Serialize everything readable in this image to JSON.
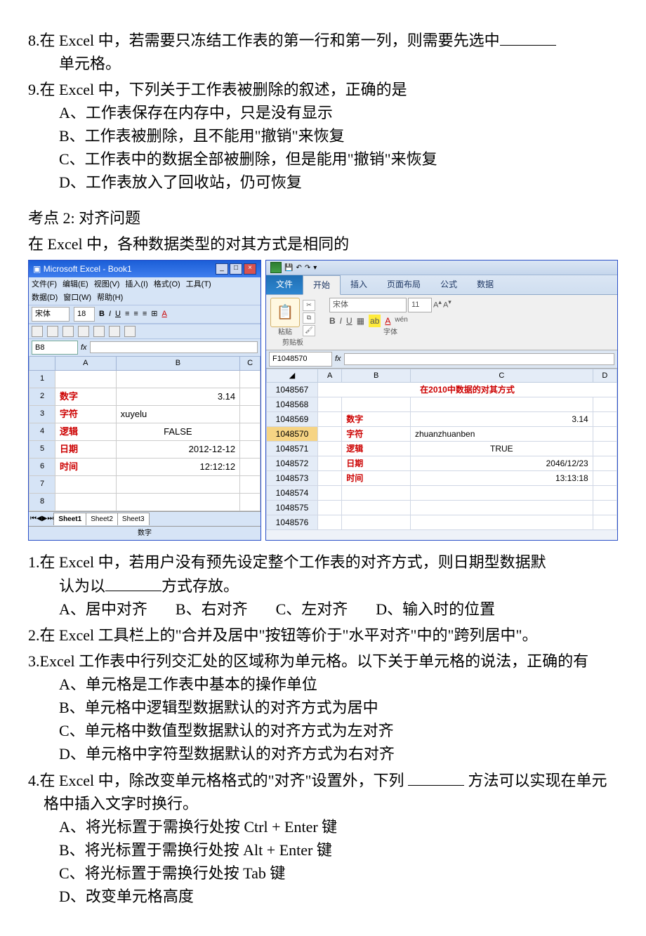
{
  "q8": {
    "text_a": "8.在 Excel 中，若需要只冻结工作表的第一行和第一列，则需要先选中",
    "text_b": "单元格。"
  },
  "q9": {
    "text": "9.在 Excel 中，下列关于工作表被删除的叙述，正确的是",
    "A": "A、工作表保存在内存中，只是没有显示",
    "B": "B、工作表被删除，且不能用\"撤销\"来恢复",
    "C": "C、工作表中的数据全部被删除，但是能用\"撤销\"来恢复",
    "D": "D、工作表放入了回收站，仍可恢复"
  },
  "kd2": {
    "title": "考点 2: 对齐问题",
    "intro": " 在 Excel 中，各种数据类型的对其方式是相同的"
  },
  "excel2003": {
    "title": "Microsoft Excel - Book1",
    "menus": [
      "文件(F)",
      "编辑(E)",
      "视图(V)",
      "插入(I)",
      "格式(O)",
      "工具(T)",
      "数据(D)",
      "窗口(W)",
      "帮助(H)"
    ],
    "font": "宋体",
    "fontsize": "18",
    "namebox": "B8",
    "cols": [
      "",
      "A",
      "B",
      "C"
    ],
    "rows": [
      {
        "n": "1",
        "a": "",
        "b": "",
        "c": ""
      },
      {
        "n": "2",
        "a": "数字",
        "b": "3.14",
        "c": "",
        "balign": "right",
        "ared": true
      },
      {
        "n": "3",
        "a": "字符",
        "b": "xuyelu",
        "c": "",
        "balign": "left",
        "ared": true
      },
      {
        "n": "4",
        "a": "逻辑",
        "b": "FALSE",
        "c": "",
        "balign": "center",
        "ared": true
      },
      {
        "n": "5",
        "a": "日期",
        "b": "2012-12-12",
        "c": "",
        "balign": "right",
        "ared": true
      },
      {
        "n": "6",
        "a": "时间",
        "b": "12:12:12",
        "c": "",
        "balign": "right",
        "ared": true
      },
      {
        "n": "7",
        "a": "",
        "b": "",
        "c": ""
      },
      {
        "n": "8",
        "a": "",
        "b": "",
        "c": ""
      }
    ],
    "sheets": [
      "Sheet1",
      "Sheet2",
      "Sheet3"
    ],
    "status": "数字"
  },
  "excel2010": {
    "tabs": [
      "文件",
      "开始",
      "插入",
      "页面布局",
      "公式",
      "数据"
    ],
    "clipboard": "粘贴",
    "clip_label": "剪贴板",
    "font": "宋体",
    "fontsize": "11",
    "font_label": "字体",
    "namebox": "F1048570",
    "cols": [
      "",
      "A",
      "B",
      "C",
      "D"
    ],
    "merged_title": "在2010中数据的对其方式",
    "rows": [
      {
        "n": "1048567"
      },
      {
        "n": "1048568"
      },
      {
        "n": "1048569",
        "b": "数字",
        "c": "3.14",
        "calign": "right",
        "bred": true
      },
      {
        "n": "1048570",
        "b": "字符",
        "c": "zhuanzhuanben",
        "calign": "left",
        "bred": true,
        "sel": true
      },
      {
        "n": "1048571",
        "b": "逻辑",
        "c": "TRUE",
        "calign": "center",
        "bred": true
      },
      {
        "n": "1048572",
        "b": "日期",
        "c": "2046/12/23",
        "calign": "right",
        "bred": true
      },
      {
        "n": "1048573",
        "b": "时间",
        "c": "13:13:18",
        "calign": "right",
        "bred": true
      },
      {
        "n": "1048574"
      },
      {
        "n": "1048575"
      },
      {
        "n": "1048576"
      }
    ]
  },
  "q1": {
    "text_a": "1.在 Excel 中，若用户没有预先设定整个工作表的对齐方式，则日期型数据默认为以",
    "text_b": "方式存放。",
    "A": "A、居中对齐",
    "B": "B、右对齐",
    "C": "C、左对齐",
    "D": "D、输入时的位置"
  },
  "q2": "2.在 Excel 工具栏上的\"合并及居中\"按钮等价于\"水平对齐\"中的\"跨列居中\"。",
  "q3": {
    "text": "3.Excel 工作表中行列交汇处的区域称为单元格。以下关于单元格的说法，正确的有",
    "A": "A、单元格是工作表中基本的操作单位",
    "B": "B、单元格中逻辑型数据默认的对齐方式为居中",
    "C": "C、单元格中数值型数据默认的对齐方式为左对齐",
    "D": "D、单元格中字符型数据默认的对齐方式为右对齐"
  },
  "q4": {
    "text_a": "4.在 Excel 中，除改变单元格格式的\"对齐\"设置外，下列 ",
    "text_b": " 方法可以实现在单元格中插入文字时换行。",
    "A": "A、将光标置于需换行处按 Ctrl + Enter 键",
    "B": "B、将光标置于需换行处按 Alt + Enter 键",
    "C": "C、将光标置于需换行处按 Tab 键",
    "D": "D、改变单元格高度"
  }
}
